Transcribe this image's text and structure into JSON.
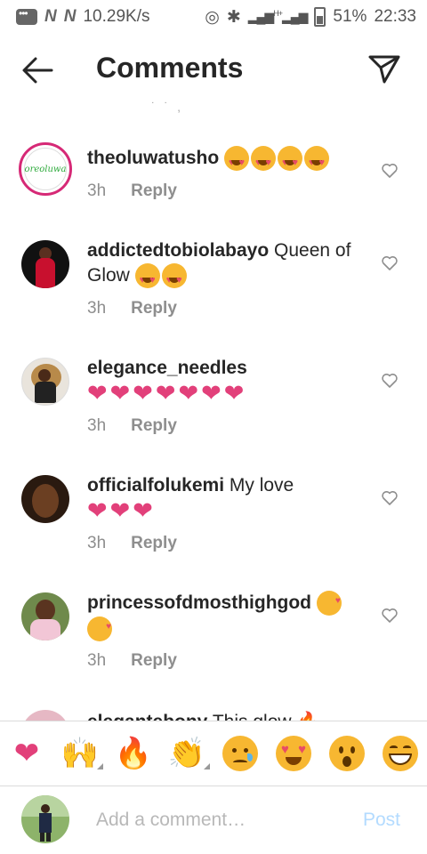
{
  "status_bar": {
    "speed": "10.29K/s",
    "network_label": "H+",
    "battery": "51%",
    "time": "22:33"
  },
  "header": {
    "title": "Comments"
  },
  "comments": [
    {
      "username": "theoluwatusho",
      "text": "",
      "emojis": [
        "smiling-face-with-heart-eyes",
        "smiling-face-with-heart-eyes",
        "smiling-face-with-heart-eyes",
        "smiling-face-with-heart-eyes"
      ],
      "time": "3h",
      "reply_label": "Reply",
      "avatar_text": "oreoluwa"
    },
    {
      "username": "addictedtobiolabayo",
      "text": "Queen of Glow",
      "emojis": [
        "smiling-face-with-heart-eyes",
        "smiling-face-with-heart-eyes"
      ],
      "time": "3h",
      "reply_label": "Reply"
    },
    {
      "username": "elegance_needles",
      "text": "",
      "emojis": [
        "pink-heart",
        "pink-heart",
        "pink-heart",
        "pink-heart",
        "pink-heart",
        "pink-heart",
        "pink-heart"
      ],
      "time": "3h",
      "reply_label": "Reply"
    },
    {
      "username": "officialfolukemi",
      "text": "My love",
      "emojis": [
        "pink-heart",
        "pink-heart",
        "pink-heart"
      ],
      "time": "3h",
      "reply_label": "Reply"
    },
    {
      "username": "princessofdmosthighgod",
      "text": "",
      "emojis": [
        "face-blowing-kiss",
        "face-blowing-kiss"
      ],
      "time": "3h",
      "reply_label": "Reply"
    },
    {
      "username": "elegantebony",
      "text": "This glow",
      "emojis": [
        "fire"
      ],
      "time": "",
      "reply_label": ""
    }
  ],
  "emoji_bar": [
    {
      "name": "heart",
      "glyph": "❤"
    },
    {
      "name": "raising-hands",
      "glyph": "🙌"
    },
    {
      "name": "fire",
      "glyph": "🔥"
    },
    {
      "name": "clapping-hands",
      "glyph": "👏"
    },
    {
      "name": "crying-face",
      "glyph": ""
    },
    {
      "name": "heart-eyes",
      "glyph": ""
    },
    {
      "name": "surprised-face",
      "glyph": ""
    },
    {
      "name": "grinning-squinting-face",
      "glyph": ""
    }
  ],
  "composer": {
    "placeholder": "Add a comment…",
    "post_label": "Post"
  },
  "colors": {
    "heart": "#e2407a",
    "emoji_yellow": "#f7b731",
    "post_disabled": "#b3dbff",
    "muted": "#8e8e8e"
  }
}
